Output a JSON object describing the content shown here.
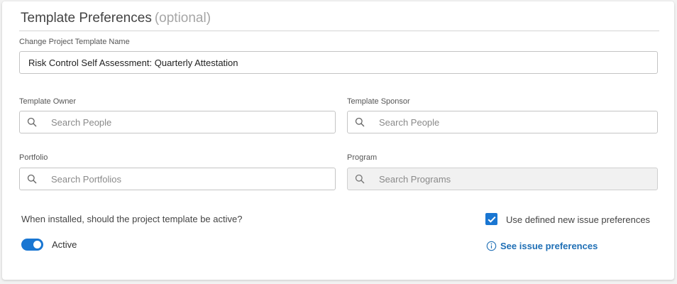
{
  "section": {
    "title": "Template Preferences",
    "optional": "(optional)"
  },
  "template_name": {
    "label": "Change Project Template Name",
    "value": "Risk Control Self Assessment: Quarterly Attestation"
  },
  "owner": {
    "label": "Template Owner",
    "placeholder": "Search People"
  },
  "sponsor": {
    "label": "Template Sponsor",
    "placeholder": "Search People"
  },
  "portfolio": {
    "label": "Portfolio",
    "placeholder": "Search Portfolios"
  },
  "program": {
    "label": "Program",
    "placeholder": "Search Programs",
    "disabled": true
  },
  "active_question": "When installed, should the project template be active?",
  "active_toggle": {
    "label": "Active",
    "on": true
  },
  "issue_prefs": {
    "checkbox_label": "Use defined new issue preferences",
    "checked": true,
    "link": "See issue preferences"
  },
  "colors": {
    "accent": "#1976d2",
    "link": "#1f6fb5"
  },
  "icons": {
    "search": "search-icon",
    "info": "info-icon",
    "check": "check-icon"
  }
}
